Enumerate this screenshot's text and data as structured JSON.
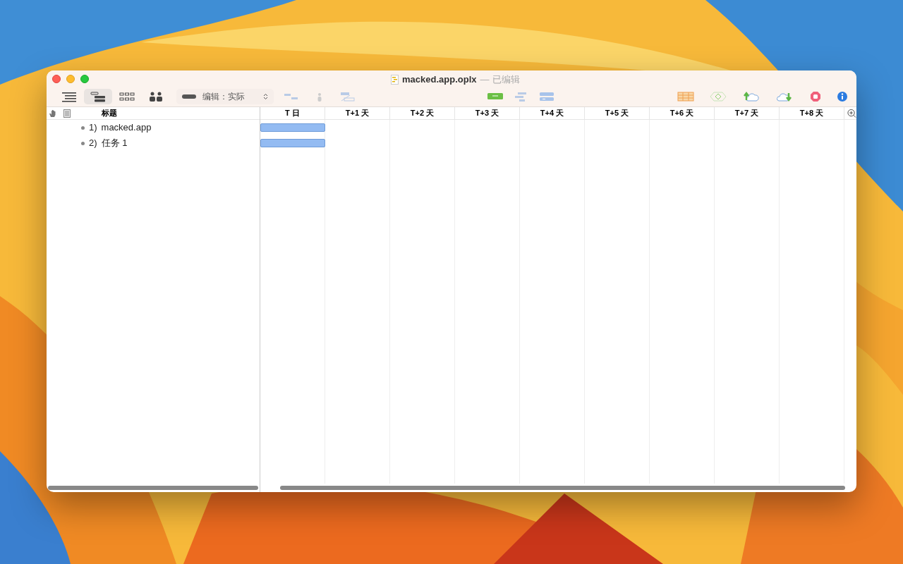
{
  "window": {
    "title": "macked.app.oplx",
    "separator": "—",
    "status": "已编辑"
  },
  "toolbar": {
    "views": [
      {
        "kind": "outline",
        "selected": false
      },
      {
        "kind": "gantt",
        "selected": true
      },
      {
        "kind": "network",
        "selected": false
      },
      {
        "kind": "resources",
        "selected": false
      }
    ],
    "edit_mode": "编辑：实际"
  },
  "outline": {
    "header": "标题",
    "rows": [
      {
        "number": "1)",
        "title": "macked.app",
        "scheduled": true
      },
      {
        "number": "2)",
        "title": "任务 1",
        "scheduled": true
      }
    ]
  },
  "gantt": {
    "columns": [
      "T 日",
      "T+1 天",
      "T+2 天",
      "T+3 天",
      "T+4 天",
      "T+5 天",
      "T+6 天",
      "T+7 天",
      "T+8 天"
    ]
  }
}
